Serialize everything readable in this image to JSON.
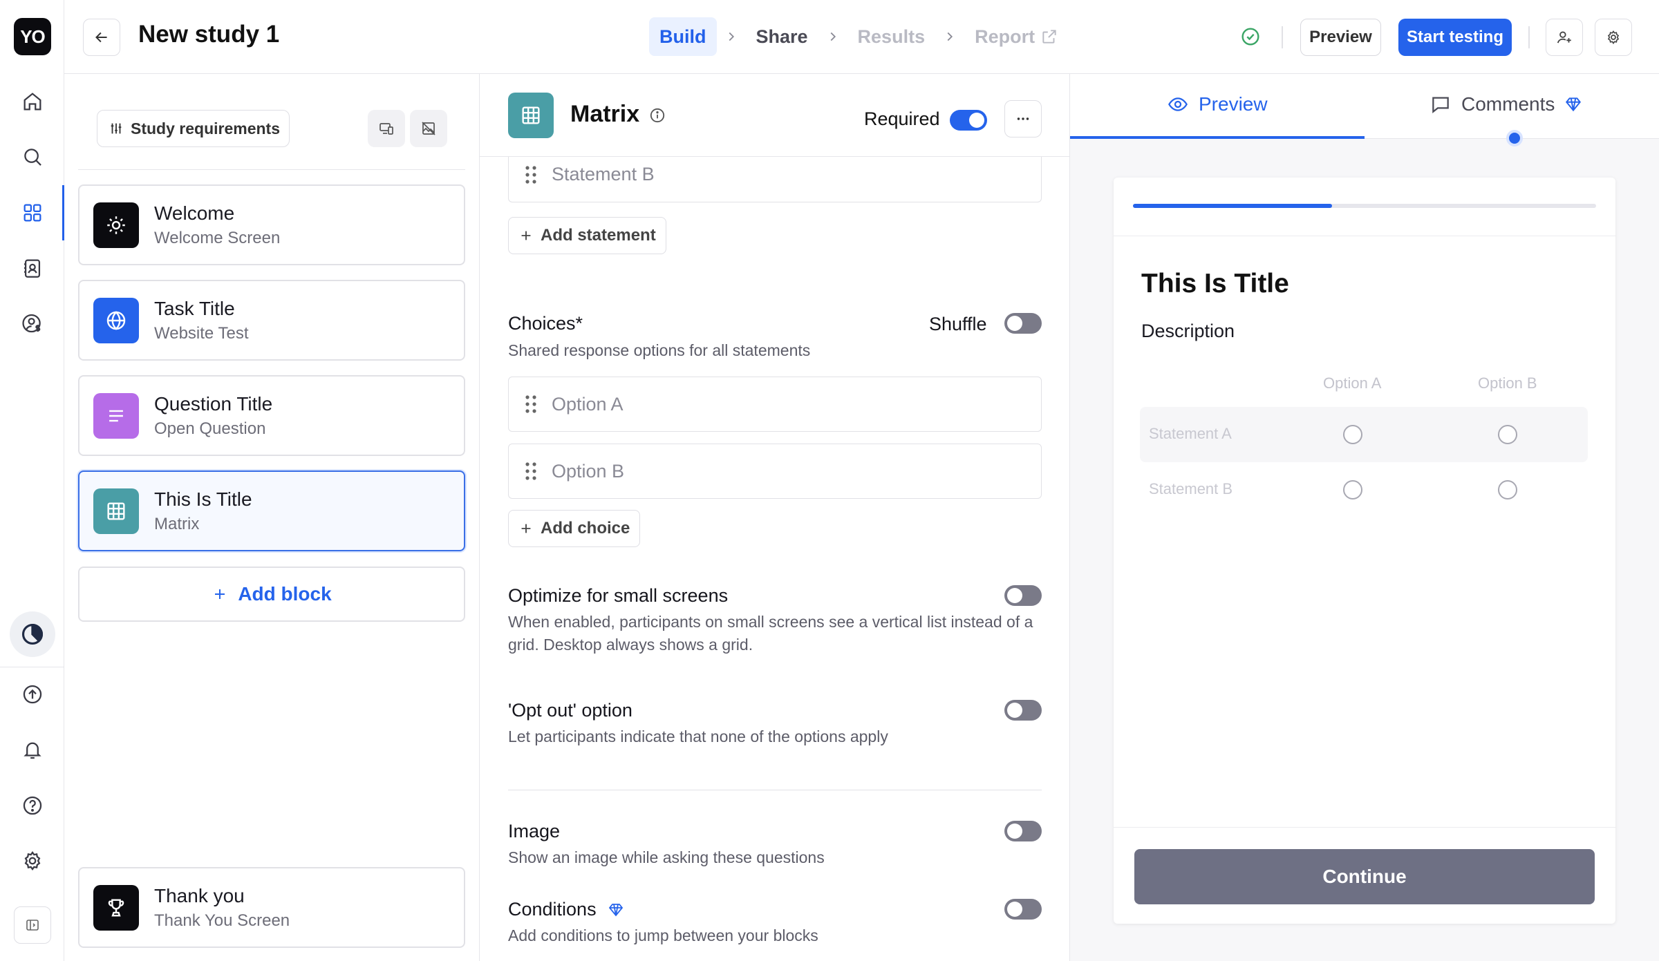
{
  "app": {
    "logo": "YO"
  },
  "rail": {
    "items": [
      {
        "icon": "home-icon"
      },
      {
        "icon": "search-icon"
      },
      {
        "icon": "grid-icon",
        "active": true
      },
      {
        "icon": "contacts-icon"
      },
      {
        "icon": "user-dollar-icon"
      },
      {
        "icon": "pie-chart-icon"
      },
      {
        "icon": "upload-icon"
      },
      {
        "icon": "bell-icon"
      },
      {
        "icon": "help-icon"
      },
      {
        "icon": "settings-icon"
      },
      {
        "icon": "sidebar-collapse-icon"
      }
    ]
  },
  "header": {
    "title": "New study 1",
    "steps": [
      {
        "label": "Build",
        "state": "active"
      },
      {
        "label": "Share",
        "state": "done"
      },
      {
        "label": "Results",
        "state": "disabled"
      },
      {
        "label": "Report",
        "state": "disabled"
      }
    ],
    "preview_label": "Preview",
    "start_label": "Start testing"
  },
  "blocks": {
    "requirements_label": "Study requirements",
    "items": [
      {
        "title": "Welcome",
        "subtitle": "Welcome Screen",
        "color": "#0b0b0f",
        "icon": "sun-icon"
      },
      {
        "title": "Task Title",
        "subtitle": "Website Test",
        "color": "#2563eb",
        "icon": "globe-icon"
      },
      {
        "title": "Question Title",
        "subtitle": "Open Question",
        "color": "#b66ce8",
        "icon": "lines-icon"
      },
      {
        "title": "This Is Title",
        "subtitle": "Matrix",
        "color": "#4a9ea6",
        "icon": "table-icon",
        "selected": true
      }
    ],
    "add_label": "Add block",
    "footer_block": {
      "title": "Thank you",
      "subtitle": "Thank You Screen",
      "color": "#0b0b0f",
      "icon": "trophy-icon"
    }
  },
  "editor": {
    "type_label": "Matrix",
    "required_label": "Required",
    "required_on": true,
    "statements": [
      "Statement B"
    ],
    "add_statement_label": "Add statement",
    "choices_title": "Choices*",
    "choices_desc": "Shared response options for all statements",
    "shuffle_label": "Shuffle",
    "choices": [
      "Option A",
      "Option B"
    ],
    "add_choice_label": "Add choice",
    "settings": [
      {
        "title": "Optimize for small screens",
        "desc": "When enabled, participants on small screens see a vertical list instead of a grid. Desktop always shows a grid."
      },
      {
        "title": "'Opt out' option",
        "desc": "Let participants indicate that none of the options apply"
      },
      {
        "title": "Image",
        "desc": "Show an image while asking these questions"
      },
      {
        "title": "Conditions",
        "desc": "Add conditions to jump between your blocks"
      }
    ]
  },
  "preview": {
    "tabs": [
      {
        "label": "Preview",
        "icon": "eye-icon"
      },
      {
        "label": "Comments",
        "icon": "comment-icon"
      }
    ],
    "progress": 0.43,
    "title": "This Is Title",
    "description": "Description",
    "columns": [
      "Option A",
      "Option B"
    ],
    "rows": [
      "Statement A",
      "Statement B"
    ],
    "continue_label": "Continue"
  },
  "colors": {
    "accent": "#2563eb",
    "matrix": "#4a9ea6"
  }
}
